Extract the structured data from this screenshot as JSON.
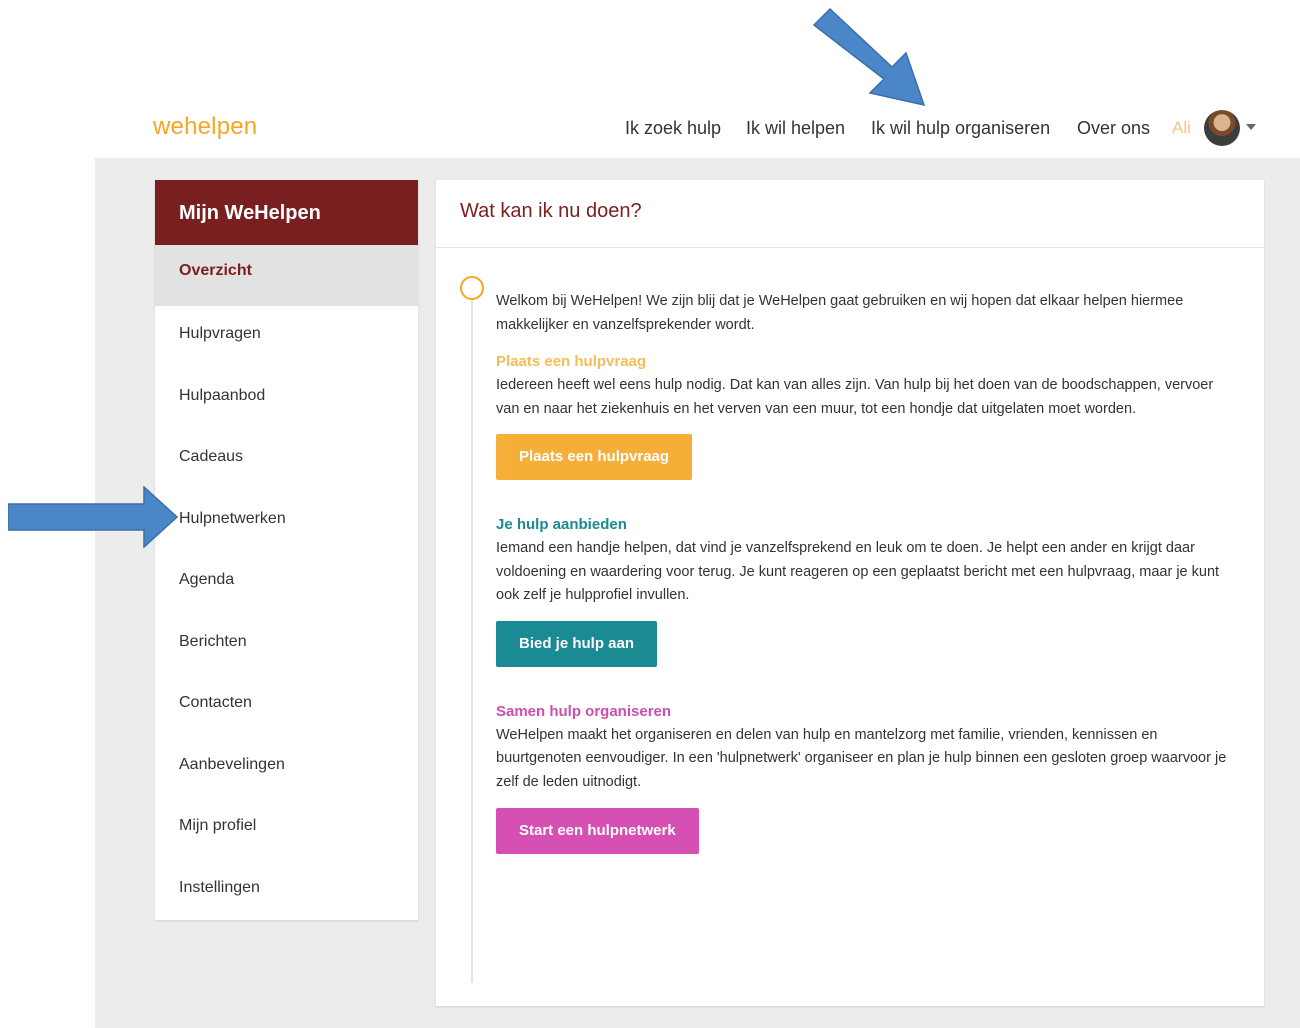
{
  "brand": {
    "logo": "wehelpen",
    "accent": "#f5a623",
    "primary": "#7a1f1f"
  },
  "nav": {
    "items": [
      {
        "label": "Ik zoek hulp"
      },
      {
        "label": "Ik wil helpen"
      },
      {
        "label": "Ik wil hulp organiseren"
      },
      {
        "label": "Over ons"
      }
    ],
    "user_name": "Ali",
    "avatar_icon": "user-avatar",
    "caret_icon": "caret-down-icon"
  },
  "sidebar": {
    "title": "Mijn WeHelpen",
    "items": [
      {
        "label": "Overzicht",
        "active": true
      },
      {
        "label": "Hulpvragen"
      },
      {
        "label": "Hulpaanbod"
      },
      {
        "label": "Cadeaus"
      },
      {
        "label": "Hulpnetwerken"
      },
      {
        "label": "Agenda"
      },
      {
        "label": "Berichten"
      },
      {
        "label": "Contacten"
      },
      {
        "label": "Aanbevelingen"
      },
      {
        "label": "Mijn profiel"
      },
      {
        "label": "Instellingen"
      }
    ]
  },
  "main": {
    "title": "Wat kan ik nu doen?",
    "intro": "Welkom bij WeHelpen! We zijn blij dat je WeHelpen gaat gebruiken en wij hopen dat elkaar helpen hiermee makkelijker en vanzelfsprekender wordt.",
    "sections": [
      {
        "title": "Plaats een hulpvraag",
        "text": "Iedereen heeft wel eens hulp nodig. Dat kan van alles zijn. Van hulp bij het doen van de boodschappen, vervoer van en naar het ziekenhuis en het verven van een muur, tot een hondje dat uitgelaten moet worden.",
        "button": "Plaats een hulpvraag",
        "color": "#f5a623"
      },
      {
        "title": "Je hulp aanbieden",
        "text": "Iemand een handje helpen, dat vind je vanzelfsprekend en leuk om te doen. Je helpt een ander en krijgt daar voldoening en waardering voor terug. Je kunt reageren op een geplaatst bericht met een hulpvraag, maar je kunt ook zelf je hulpprofiel invullen.",
        "button": "Bied je hulp aan",
        "color": "#1a8a93"
      },
      {
        "title": "Samen hulp organiseren",
        "text": "WeHelpen maakt het organiseren en delen van hulp en mantelzorg met familie, vrienden, kennissen en buurtgenoten eenvoudiger. In een 'hulpnetwerk' organiseer en plan je hulp binnen een gesloten groep waarvoor je zelf de leden uitnodigt.",
        "button": "Start een hulpnetwerk",
        "color": "#d64fb3"
      }
    ]
  },
  "annotations": {
    "arrow_color": "#4a86c8"
  }
}
